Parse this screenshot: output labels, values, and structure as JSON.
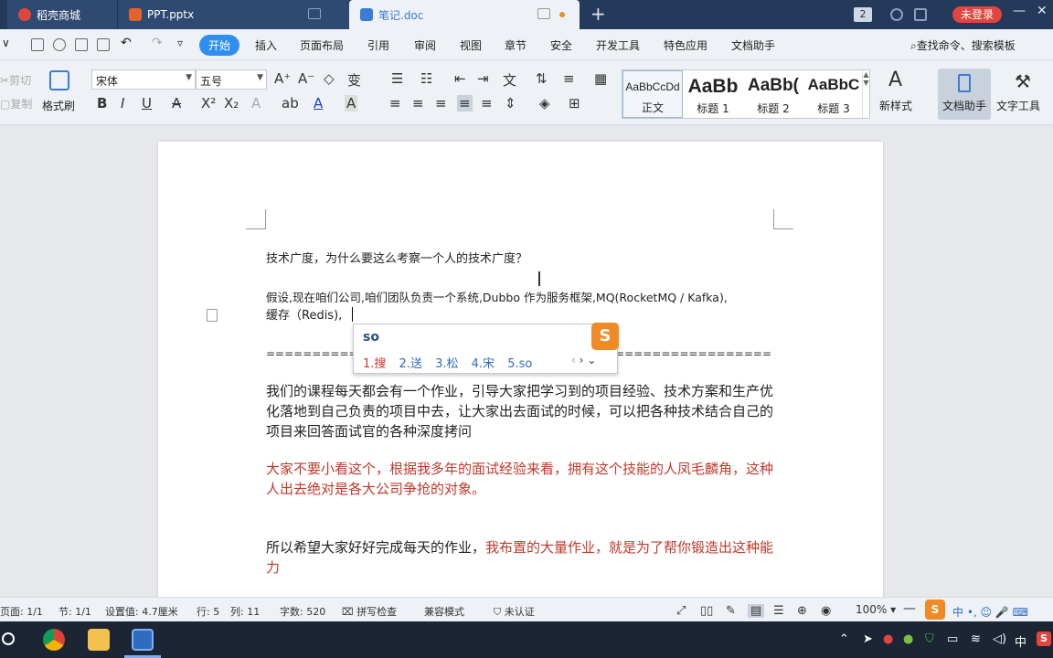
{
  "tabs": [
    {
      "label": "稻壳商城",
      "icon": "daoke-icon",
      "color": "#e0463d"
    },
    {
      "label": "PPT.pptx",
      "icon": "ppt-icon",
      "color": "#e2632f"
    },
    {
      "label": "笔记.doc",
      "icon": "word-doc-icon",
      "color": "#3a7bd5"
    }
  ],
  "titlebar": {
    "badge": "2",
    "login_label": "未登录"
  },
  "menu": {
    "items": [
      "开始",
      "插入",
      "页面布局",
      "引用",
      "审阅",
      "视图",
      "章节",
      "安全",
      "开发工具",
      "特色应用",
      "文档助手"
    ],
    "search_label": "查找命令、搜索模板"
  },
  "ribbon": {
    "cut": "剪切",
    "copy": "复制",
    "format_painter": "格式刷",
    "font_name": "宋体",
    "font_size": "五号",
    "styles": [
      {
        "sample": "AaBbCcDd",
        "name": "正文"
      },
      {
        "sample": "AaBb",
        "name": "标题 1"
      },
      {
        "sample": "AaBb(",
        "name": "标题 2"
      },
      {
        "sample": "AaBbC",
        "name": "标题 3"
      }
    ],
    "new_style": "新样式",
    "doc_assistant": "文档助手",
    "text_tools": "文字工具"
  },
  "document": {
    "line1": "技术广度，为什么要这么考察一个人的技术广度？",
    "line2a": "假设,现在咱们公司,咱们团队负责一个系统,Dubbo 作为服务框架,MQ(RocketMQ / Kafka),",
    "line2b": "缓存（Redis),",
    "separator": "================================================================================================",
    "para3": "我们的课程每天都会有一个作业，引导大家把学习到的项目经验、技术方案和生产优化落地到自己负责的项目中去，让大家出去面试的时候，可以把各种技术结合自己的项目来回答面试官的各种深度拷问",
    "para4": "大家不要小看这个，根据我多年的面试经验来看，拥有这个技能的人凤毛麟角，这种人出去绝对是各大公司争抢的对象。",
    "para5_black": "所以希望大家好好完成每天的作业，",
    "para5_red": "我布置的大量作业，就是为了帮你锻造出这种能力"
  },
  "ime": {
    "input": "so",
    "candidates": [
      "1.搜",
      "2.送",
      "3.松",
      "4.宋",
      "5.so"
    ],
    "logo": "S"
  },
  "status": {
    "page": "页面: 1/1",
    "section": "节: 1/1",
    "setting": "设置值: 4.7厘米",
    "row": "行: 5",
    "col": "列: 11",
    "words": "字数: 520",
    "spell": "拼写检查",
    "compat": "兼容模式",
    "cert": "未认证",
    "zoom": "100%"
  },
  "taskbar": {
    "ime_lang": "中"
  }
}
